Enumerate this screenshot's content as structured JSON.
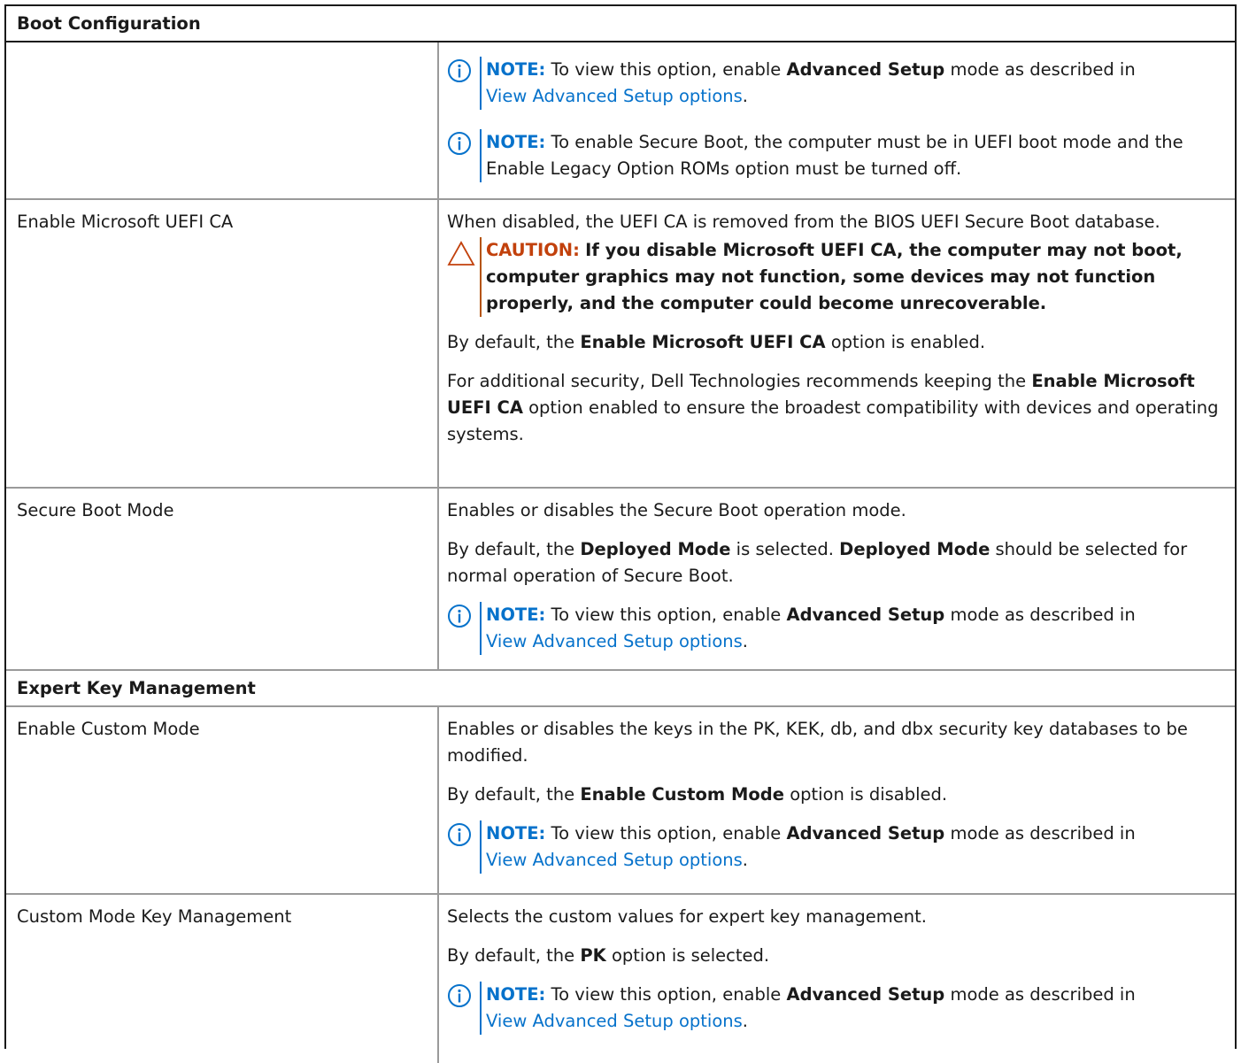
{
  "sections": {
    "boot_configuration": "Boot Configuration",
    "expert_key_management": "Expert Key Management"
  },
  "colors": {
    "info": "#0672cb",
    "caution": "#c2410c",
    "row_rule": "#9a9a9a"
  },
  "icons": {
    "note": "info-icon",
    "caution": "caution-triangle-icon"
  },
  "note_label": "NOTE:",
  "caution_label": "CAUTION:",
  "advanced_note": {
    "pre": "To view this option, enable",
    "bold": "Advanced Setup",
    "post": "mode as described in",
    "link": "View Advanced Setup options",
    "end": "."
  },
  "secure_boot_note": "To enable Secure Boot, the computer must be in UEFI boot mode and the Enable Legacy Option ROMs option must be turned off.",
  "rows": {
    "uefi_ca": {
      "name": "Enable Microsoft UEFI CA",
      "desc": "When disabled, the UEFI CA is removed from the BIOS UEFI Secure Boot database.",
      "caution": "If you disable Microsoft UEFI CA, the computer may not boot, computer graphics may not function, some devices may not function properly, and the computer could become unrecoverable.",
      "default_pre": "By default, the",
      "default_bold": "Enable Microsoft UEFI CA",
      "default_post": "option is enabled.",
      "rec_pre": "For additional security, Dell Technologies recommends keeping the",
      "rec_bold": "Enable Microsoft UEFI CA",
      "rec_post": "option enabled to ensure the broadest compatibility with devices and operating systems."
    },
    "secure_boot_mode": {
      "name": "Secure Boot Mode",
      "desc": "Enables or disables the Secure Boot operation mode.",
      "default_pre": "By default, the",
      "default_bold": "Deployed Mode",
      "default_mid": "is selected.",
      "default_bold2": "Deployed Mode",
      "default_post": "should be selected for normal operation of Secure Boot."
    },
    "custom_mode": {
      "name": "Enable Custom Mode",
      "desc": "Enables or disables the keys in the PK, KEK, db, and dbx security key databases to be modified.",
      "default_pre": "By default, the",
      "default_bold": "Enable Custom Mode",
      "default_post": "option is disabled."
    },
    "custom_key_mgmt": {
      "name": "Custom Mode Key Management",
      "desc": "Selects the custom values for expert key management.",
      "default_pre": "By default, the",
      "default_bold": "PK",
      "default_post": "option is selected."
    }
  }
}
